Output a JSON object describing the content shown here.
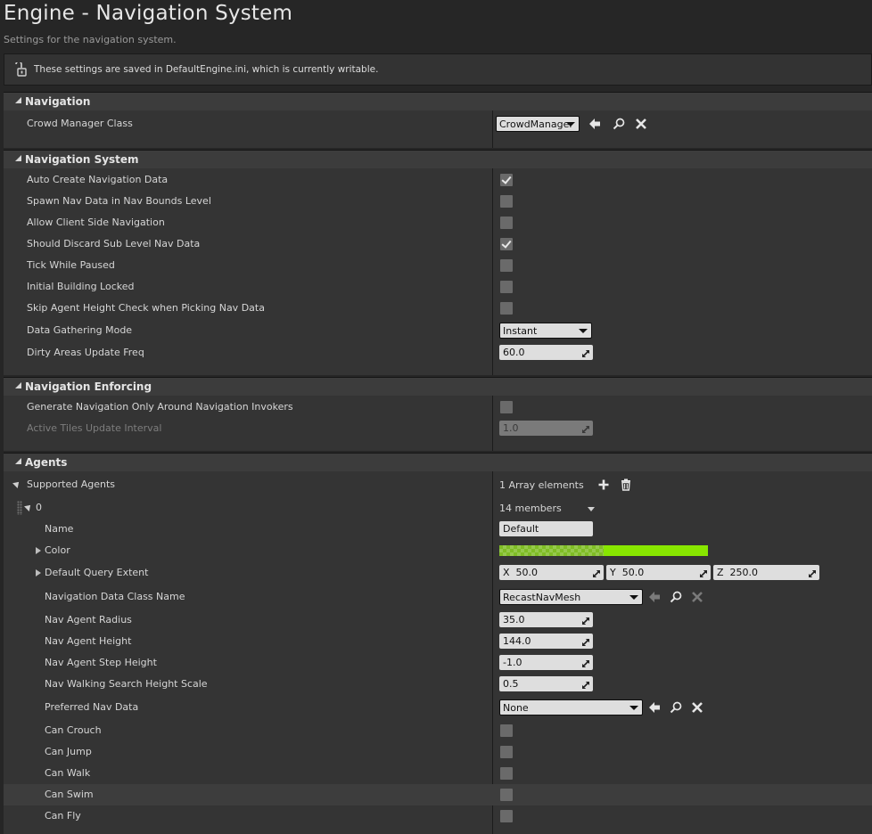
{
  "page": {
    "title": "Engine - Navigation System",
    "subtitle": "Settings for the navigation system.",
    "notice": "These settings are saved in DefaultEngine.ini, which is currently writable."
  },
  "sections": {
    "navigation": {
      "label": "Navigation",
      "crowd_manager_class": {
        "label": "Crowd Manager Class",
        "value": "CrowdManager"
      }
    },
    "navigation_system": {
      "label": "Navigation System",
      "auto_create": {
        "label": "Auto Create Navigation Data",
        "checked": true
      },
      "spawn_nav_data": {
        "label": "Spawn Nav Data in Nav Bounds Level",
        "checked": false
      },
      "allow_client_side": {
        "label": "Allow Client Side Navigation",
        "checked": false
      },
      "discard_sub_level": {
        "label": "Should Discard Sub Level Nav Data",
        "checked": true
      },
      "tick_while_paused": {
        "label": "Tick While Paused",
        "checked": false
      },
      "initial_building_locked": {
        "label": "Initial Building Locked",
        "checked": false
      },
      "skip_agent_height": {
        "label": "Skip Agent Height Check when Picking Nav Data",
        "checked": false
      },
      "data_gathering_mode": {
        "label": "Data Gathering Mode",
        "value": "Instant"
      },
      "dirty_areas_freq": {
        "label": "Dirty Areas Update Freq",
        "value": "60.0"
      }
    },
    "navigation_enforcing": {
      "label": "Navigation Enforcing",
      "generate_only_invokers": {
        "label": "Generate Navigation Only Around Navigation Invokers",
        "checked": false
      },
      "active_tiles_interval": {
        "label": "Active Tiles Update Interval",
        "value": "1.0"
      }
    },
    "agents": {
      "label": "Agents",
      "supported_agents": {
        "label": "Supported Agents",
        "count": "1 Array elements"
      },
      "element": {
        "index": "0",
        "members": "14 members",
        "name": {
          "label": "Name",
          "value": "Default"
        },
        "color": {
          "label": "Color",
          "hex": "#88e600"
        },
        "query_extent": {
          "label": "Default Query Extent",
          "x_label": "X",
          "x": "50.0",
          "y_label": "Y",
          "y": "50.0",
          "z_label": "Z",
          "z": "250.0"
        },
        "nav_data_class": {
          "label": "Navigation Data Class Name",
          "value": "RecastNavMesh"
        },
        "radius": {
          "label": "Nav Agent Radius",
          "value": "35.0"
        },
        "height": {
          "label": "Nav Agent Height",
          "value": "144.0"
        },
        "step_height": {
          "label": "Nav Agent Step Height",
          "value": "-1.0"
        },
        "search_height_scale": {
          "label": "Nav Walking Search Height Scale",
          "value": "0.5"
        },
        "preferred_nav_data": {
          "label": "Preferred Nav Data",
          "value": "None"
        },
        "can_crouch": {
          "label": "Can Crouch",
          "checked": false
        },
        "can_jump": {
          "label": "Can Jump",
          "checked": false
        },
        "can_walk": {
          "label": "Can Walk",
          "checked": false
        },
        "can_swim": {
          "label": "Can Swim",
          "checked": false
        },
        "can_fly": {
          "label": "Can Fly",
          "checked": false
        }
      }
    }
  },
  "colors": {
    "background": "#262626",
    "section_header": "#3c3c3c",
    "row_bg": "#343434",
    "field": "#dedede",
    "agent_color": "#88e600"
  }
}
